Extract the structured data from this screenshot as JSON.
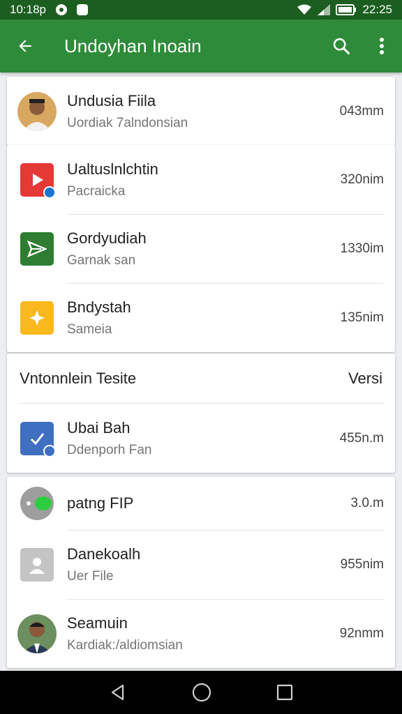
{
  "status_bar": {
    "left_text": "10:18p",
    "time": "22:25"
  },
  "app_bar": {
    "title": "Undoyhan Inoain"
  },
  "colors": {
    "app_bar": "#2e8b3a",
    "status_bar": "#1b5e20",
    "red": "#e53935",
    "green": "#2e7d32",
    "yellow": "#f9b81b",
    "blue": "#3f6fc0"
  },
  "card1": {
    "items": [
      {
        "primary": "Undusia Fiila",
        "secondary": "Uordiak 7alndonsian",
        "meta": "043mm",
        "icon": "person-avatar"
      }
    ]
  },
  "card2": {
    "items": [
      {
        "primary": "Ualtuslnlchtin",
        "secondary": "Pacraicka",
        "meta": "320nim",
        "icon": "red-play-icon"
      },
      {
        "primary": "Gordyudiah",
        "secondary": "Garnak san",
        "meta": "1330im",
        "icon": "green-send-icon"
      },
      {
        "primary": "Bndystah",
        "secondary": "Sameia",
        "meta": "135nim",
        "icon": "yellow-diamond-icon"
      }
    ]
  },
  "card3": {
    "header": {
      "left": "Vntonnlein Tesite",
      "right": "Versi"
    },
    "items": [
      {
        "primary": "Ubai Bah",
        "secondary": "Ddenporh Fan",
        "meta": "455n.m",
        "icon": "blue-clipboard-icon"
      }
    ]
  },
  "card4": {
    "items": [
      {
        "primary": "patng FIP",
        "secondary": "",
        "meta": "3.0.m",
        "icon": "toggle-icon"
      },
      {
        "primary": "Danekoalh",
        "secondary": "Uer File",
        "meta": "955nim",
        "icon": "gray-contact-icon"
      },
      {
        "primary": "Seamuin",
        "secondary": "Kardiak:/aldiomsian",
        "meta": "92nmm",
        "icon": "person-avatar"
      }
    ]
  }
}
